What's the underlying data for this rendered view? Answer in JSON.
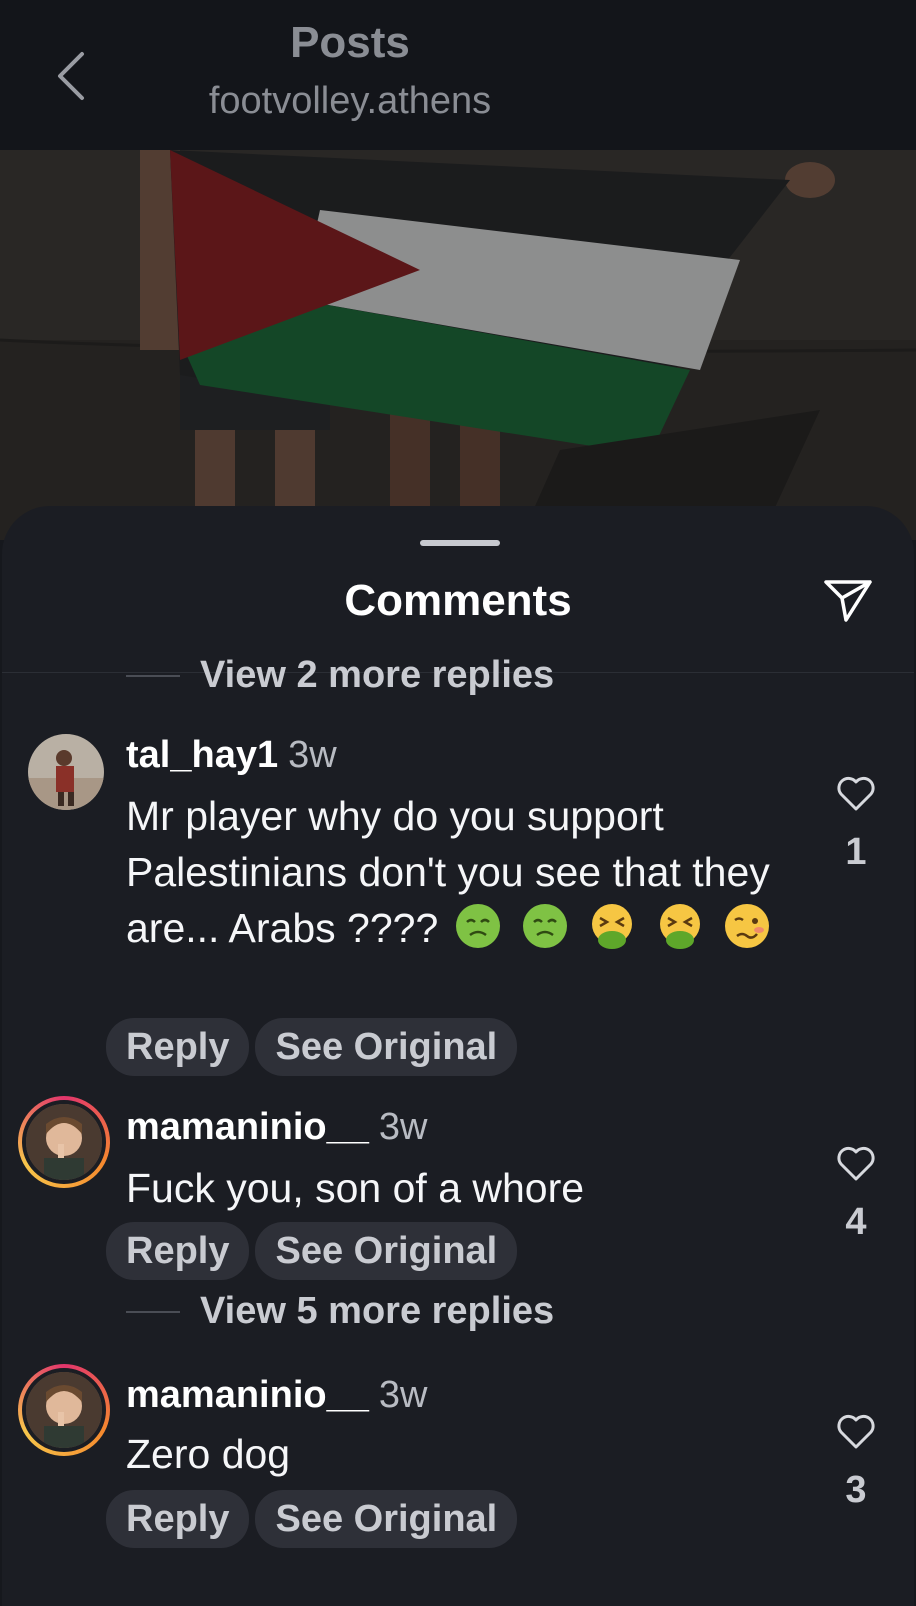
{
  "topbar": {
    "title": "Posts",
    "subtitle": "footvolley.athens"
  },
  "sheet": {
    "title": "Comments"
  },
  "threads": {
    "view_more_1": "View 2 more replies",
    "view_more_2": "View 5 more replies"
  },
  "comments": [
    {
      "username": "tal_hay1",
      "time": "3w",
      "text": "Mr player why do you support Palestinians don't you see that they are... Arabs ????",
      "emojis": [
        "nauseated-face",
        "nauseated-face",
        "vomiting-face",
        "vomiting-face",
        "woozy-face"
      ],
      "reply_label": "Reply",
      "see_original_label": "See Original",
      "likes": "1"
    },
    {
      "username": "mamaninio__",
      "time": "3w",
      "text": "Fuck you, son of a whore",
      "reply_label": "Reply",
      "see_original_label": "See Original",
      "likes": "4"
    },
    {
      "username": "mamaninio__",
      "time": "3w",
      "text": "Zero dog",
      "reply_label": "Reply",
      "see_original_label": "See Original",
      "likes": "3"
    }
  ],
  "colors": {
    "background": "#16181d",
    "sheet": "#1b1d23",
    "pill": "#2e3038",
    "story_ring": "#f58a2e"
  }
}
